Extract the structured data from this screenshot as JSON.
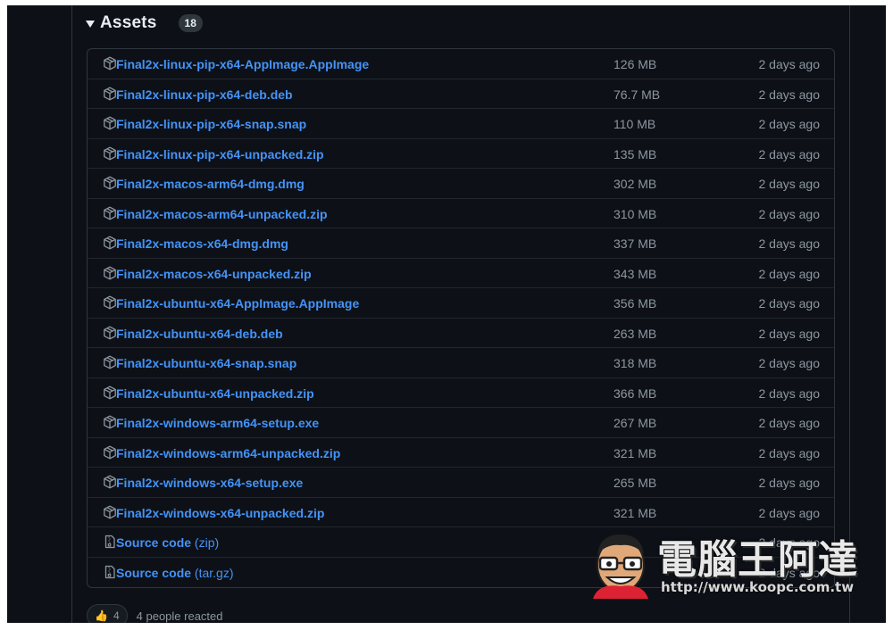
{
  "assets": {
    "title": "Assets",
    "count": "18",
    "items": [
      {
        "icon": "package-icon",
        "name": "Final2x-linux-pip-x64-AppImage.AppImage",
        "suffix": "",
        "size": "126 MB",
        "date": "2 days ago"
      },
      {
        "icon": "package-icon",
        "name": "Final2x-linux-pip-x64-deb.deb",
        "suffix": "",
        "size": "76.7 MB",
        "date": "2 days ago"
      },
      {
        "icon": "package-icon",
        "name": "Final2x-linux-pip-x64-snap.snap",
        "suffix": "",
        "size": "110 MB",
        "date": "2 days ago"
      },
      {
        "icon": "package-icon",
        "name": "Final2x-linux-pip-x64-unpacked.zip",
        "suffix": "",
        "size": "135 MB",
        "date": "2 days ago"
      },
      {
        "icon": "package-icon",
        "name": "Final2x-macos-arm64-dmg.dmg",
        "suffix": "",
        "size": "302 MB",
        "date": "2 days ago"
      },
      {
        "icon": "package-icon",
        "name": "Final2x-macos-arm64-unpacked.zip",
        "suffix": "",
        "size": "310 MB",
        "date": "2 days ago"
      },
      {
        "icon": "package-icon",
        "name": "Final2x-macos-x64-dmg.dmg",
        "suffix": "",
        "size": "337 MB",
        "date": "2 days ago"
      },
      {
        "icon": "package-icon",
        "name": "Final2x-macos-x64-unpacked.zip",
        "suffix": "",
        "size": "343 MB",
        "date": "2 days ago"
      },
      {
        "icon": "package-icon",
        "name": "Final2x-ubuntu-x64-AppImage.AppImage",
        "suffix": "",
        "size": "356 MB",
        "date": "2 days ago"
      },
      {
        "icon": "package-icon",
        "name": "Final2x-ubuntu-x64-deb.deb",
        "suffix": "",
        "size": "263 MB",
        "date": "2 days ago"
      },
      {
        "icon": "package-icon",
        "name": "Final2x-ubuntu-x64-snap.snap",
        "suffix": "",
        "size": "318 MB",
        "date": "2 days ago"
      },
      {
        "icon": "package-icon",
        "name": "Final2x-ubuntu-x64-unpacked.zip",
        "suffix": "",
        "size": "366 MB",
        "date": "2 days ago"
      },
      {
        "icon": "package-icon",
        "name": "Final2x-windows-arm64-setup.exe",
        "suffix": "",
        "size": "267 MB",
        "date": "2 days ago"
      },
      {
        "icon": "package-icon",
        "name": "Final2x-windows-arm64-unpacked.zip",
        "suffix": "",
        "size": "321 MB",
        "date": "2 days ago"
      },
      {
        "icon": "package-icon",
        "name": "Final2x-windows-x64-setup.exe",
        "suffix": "",
        "size": "265 MB",
        "date": "2 days ago"
      },
      {
        "icon": "package-icon",
        "name": "Final2x-windows-x64-unpacked.zip",
        "suffix": "",
        "size": "321 MB",
        "date": "2 days ago"
      },
      {
        "icon": "file-zip-icon",
        "name": "Source code",
        "suffix": " (zip)",
        "size": "",
        "date": "2 days ago"
      },
      {
        "icon": "file-zip-icon",
        "name": "Source code",
        "suffix": " (tar.gz)",
        "size": "",
        "date": "2 days ago"
      }
    ]
  },
  "reactions": {
    "emoji_icon": "thumbs-up-icon",
    "emoji": "👍",
    "count": "4",
    "summary": "4 people reacted"
  },
  "watermark": {
    "text": "電腦王阿達",
    "url": "http://www.koopc.com.tw"
  },
  "colors": {
    "background": "#0d1117",
    "border": "#30363d",
    "link": "#4493f8",
    "muted": "#8d96a0",
    "foreground": "#e6edf3"
  }
}
